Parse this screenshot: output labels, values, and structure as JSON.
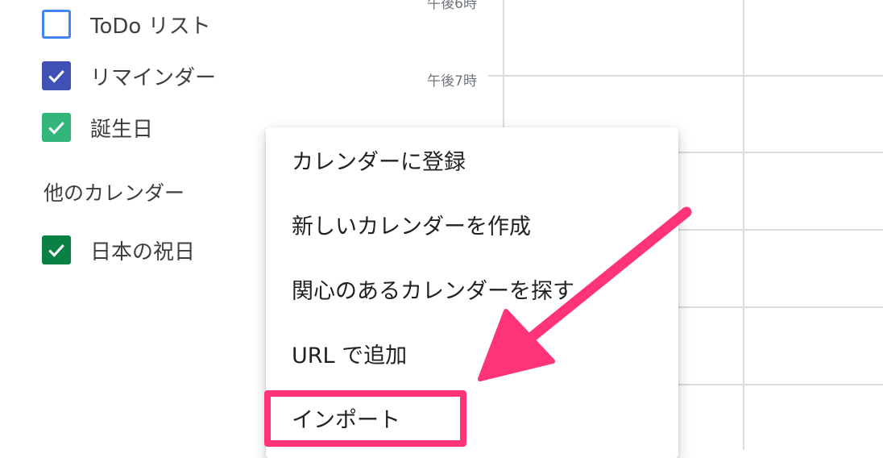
{
  "sidebar": {
    "calendars": [
      {
        "label": "ToDo リスト",
        "checked": false,
        "color": "#4285f4"
      },
      {
        "label": "リマインダー",
        "checked": true,
        "color": "#3f51b5"
      },
      {
        "label": "誕生日",
        "checked": true,
        "color": "#33b679"
      }
    ],
    "other_title": "他のカレンダー",
    "other_calendars": [
      {
        "label": "日本の祝日",
        "checked": true,
        "color": "#0b8043"
      }
    ]
  },
  "grid": {
    "time_labels": [
      "午後6時",
      "午後7時"
    ]
  },
  "menu": {
    "items": [
      {
        "label": "カレンダーに登録"
      },
      {
        "label": "新しいカレンダーを作成"
      },
      {
        "label": "関心のあるカレンダーを探す"
      },
      {
        "label": "URL で追加"
      },
      {
        "label": "インポート"
      }
    ]
  },
  "annotation": {
    "arrow_color": "#ff3377",
    "highlight_target": "インポート"
  }
}
